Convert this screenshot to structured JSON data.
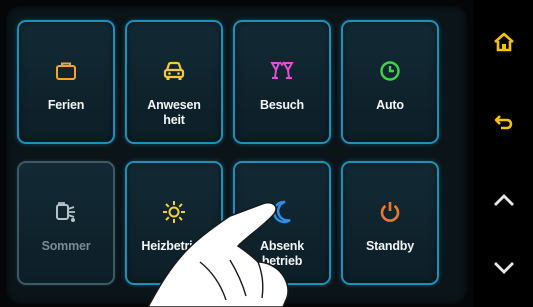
{
  "tiles": [
    {
      "label": "Ferien",
      "icon": "suitcase-icon",
      "color": "#f2a33a",
      "state": "active"
    },
    {
      "label": "Anwesen\nheit",
      "icon": "car-icon",
      "color": "#f5c842",
      "state": "active"
    },
    {
      "label": "Besuch",
      "icon": "cocktail-glasses-icon",
      "color": "#e34fd6",
      "state": "active"
    },
    {
      "label": "Auto",
      "icon": "clock-icon",
      "color": "#3fd34a",
      "state": "active"
    },
    {
      "label": "Sommer",
      "icon": "watering-can-icon",
      "color": "#b8c2c6",
      "state": "dimmed"
    },
    {
      "label": "Heizbetrieb",
      "icon": "sun-icon",
      "color": "#f5d23a",
      "state": "active"
    },
    {
      "label": "Absenk\nbetrieb",
      "icon": "moon-icon",
      "color": "#2f8de8",
      "state": "active"
    },
    {
      "label": "Standby",
      "icon": "power-icon",
      "color": "#f07a22",
      "state": "active"
    }
  ],
  "sidebar": {
    "icons": [
      "home-icon",
      "back-icon",
      "chevron-up-icon",
      "chevron-down-icon"
    ],
    "home_color": "#f5c400",
    "back_color": "#f5c400",
    "arrow_color": "#e8e8e8"
  },
  "colors": {
    "tile_border": "#1f8fb8",
    "tile_background": "#122a35",
    "background": "#050608"
  }
}
